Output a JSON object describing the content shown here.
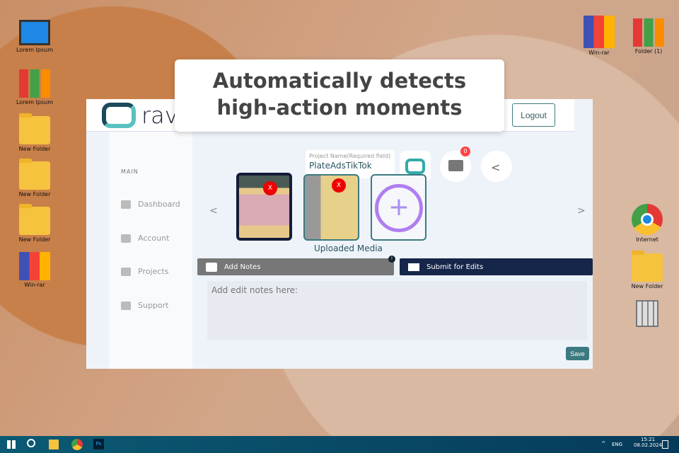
{
  "desktop_left": [
    {
      "label": "Lorem Ipsum",
      "icon": "computer-icon"
    },
    {
      "label": "Lorem Ipsum",
      "icon": "books-icon"
    },
    {
      "label": "New Folder",
      "icon": "folder-icon"
    },
    {
      "label": "New Folder",
      "icon": "folder-icon"
    },
    {
      "label": "New Folder",
      "icon": "folder-icon"
    },
    {
      "label": "Win-rar",
      "icon": "winrar-icon"
    }
  ],
  "desktop_right": [
    {
      "label": "Win-rar"
    },
    {
      "label": "Folder (1)"
    },
    {
      "label": "Internet"
    },
    {
      "label": "New Folder"
    }
  ],
  "banner": {
    "line1": "Automatically detects",
    "line2": "high-action moments"
  },
  "app": {
    "logo_text": "rav",
    "logout": "Logout",
    "sidebar_heading": "MAIN",
    "nav": [
      "Dashboard",
      "Account",
      "Projects",
      "Support"
    ],
    "project_label": "Project Name(Required field)",
    "project_name": "PlateAdsTikTok",
    "comment_badge": "0",
    "remove": "X",
    "uploaded_media": "Uploaded Media",
    "prev": "<",
    "next": ">",
    "add_notes": "Add Notes",
    "notes_badge": "!",
    "submit": "Submit for Edits",
    "notes_placeholder": "Add edit notes here:",
    "save": "Save"
  },
  "taskbar": {
    "lang": "ENG",
    "time": "15:21",
    "date": "08.02.2024",
    "ps": "Ps"
  }
}
